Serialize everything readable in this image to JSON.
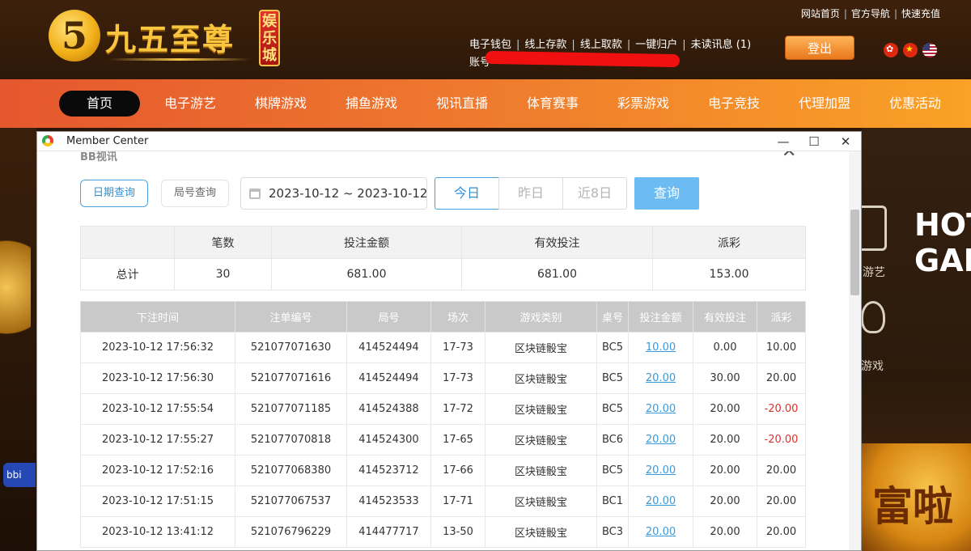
{
  "site": {
    "logo_mark": "5",
    "logo_title": "九五至尊",
    "logo_badge": "娱乐城",
    "top_links": [
      "网站首页",
      "官方导航",
      "快速充值"
    ],
    "account_links": [
      "电子钱包",
      "线上存款",
      "线上取款",
      "一键归户",
      "未读讯息 (1)"
    ],
    "account_label": "账号",
    "logout_label": "登出",
    "flags": [
      "hk-flag-icon",
      "cn-flag-icon",
      "us-flag-icon"
    ]
  },
  "nav": {
    "items": [
      "首页",
      "电子游艺",
      "棋牌游戏",
      "捕鱼游戏",
      "视讯直播",
      "体育赛事",
      "彩票游戏",
      "电子竞技",
      "代理加盟",
      "优惠活动"
    ],
    "active_index": 0
  },
  "background": {
    "hot_text": "HOT\nGAM",
    "slot_label": "游艺",
    "fish_label": "游戏",
    "bbin_label": "bbi",
    "promo_text": "富啦"
  },
  "window": {
    "title": "Member Center",
    "section_title": "BB视讯",
    "controls": {
      "minimize": "—",
      "maximize": "☐",
      "close": "✕"
    }
  },
  "filters": {
    "date_query": "日期查询",
    "round_query": "局号查询",
    "date_range": "2023-10-12 ~ 2023-10-12",
    "quick_ranges": [
      "今日",
      "昨日",
      "近8日"
    ],
    "active_range": 0,
    "query_label": "查询"
  },
  "summary": {
    "headers": [
      "",
      "笔数",
      "投注金额",
      "有效投注",
      "派彩"
    ],
    "row": [
      "总计",
      "30",
      "681.00",
      "681.00",
      "153.00"
    ]
  },
  "detail": {
    "headers": [
      "下注时间",
      "注单编号",
      "局号",
      "场次",
      "游戏类别",
      "桌号",
      "投注金额",
      "有效投注",
      "派彩"
    ],
    "rows": [
      [
        "2023-10-12 17:56:32",
        "521077071630",
        "414524494",
        "17-73",
        "区块链骰宝",
        "BC5",
        "10.00",
        "0.00",
        "10.00"
      ],
      [
        "2023-10-12 17:56:30",
        "521077071616",
        "414524494",
        "17-73",
        "区块链骰宝",
        "BC5",
        "20.00",
        "30.00",
        "20.00"
      ],
      [
        "2023-10-12 17:55:54",
        "521077071185",
        "414524388",
        "17-72",
        "区块链骰宝",
        "BC5",
        "20.00",
        "20.00",
        "-20.00"
      ],
      [
        "2023-10-12 17:55:27",
        "521077070818",
        "414524300",
        "17-65",
        "区块链骰宝",
        "BC6",
        "20.00",
        "20.00",
        "-20.00"
      ],
      [
        "2023-10-12 17:52:16",
        "521077068380",
        "414523712",
        "17-66",
        "区块链骰宝",
        "BC5",
        "20.00",
        "20.00",
        "20.00"
      ],
      [
        "2023-10-12 17:51:15",
        "521077067537",
        "414523533",
        "17-71",
        "区块链骰宝",
        "BC1",
        "20.00",
        "20.00",
        "20.00"
      ],
      [
        "2023-10-12 13:41:12",
        "521076796229",
        "414477717",
        "13-50",
        "区块链骰宝",
        "BC3",
        "20.00",
        "20.00",
        "20.00"
      ]
    ]
  },
  "colors": {
    "accent_blue": "#2f8fd5",
    "query_button": "#6cbcf3",
    "negative": "#e0312b",
    "nav_start": "#e5572e",
    "nav_end": "#f9a226"
  }
}
